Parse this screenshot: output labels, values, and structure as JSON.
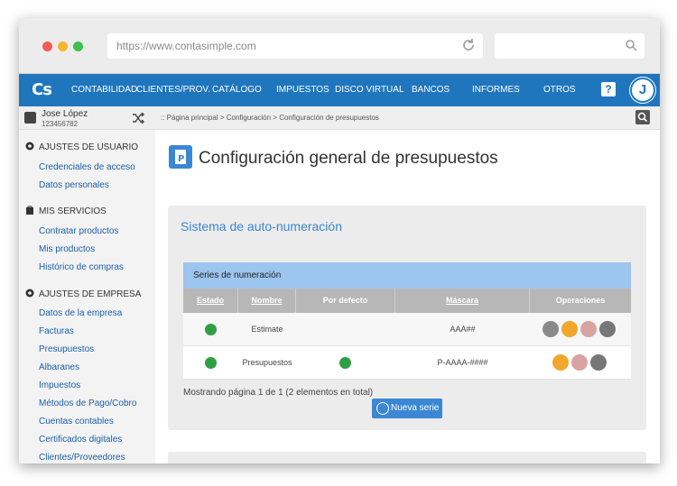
{
  "browser": {
    "url": "https://www.contasimple.com"
  },
  "topnav": {
    "logo": "Cs",
    "items": [
      "CONTABILIDAD",
      "CLIENTES/PROV.",
      "CATÁLOGO",
      "IMPUESTOS",
      "DISCO VIRTUAL",
      "BANCOS",
      "INFORMES",
      "OTROS"
    ],
    "help": "?",
    "avatar": "J",
    "color": "#1f76bd"
  },
  "user": {
    "name": "Jose López",
    "id": "123456782"
  },
  "breadcrumb": ":: Página principal > Configuración > Configuración de presupuestos",
  "sidebar": {
    "sections": [
      {
        "title": "AJUSTES DE USUARIO",
        "icon": "gear-icon",
        "items": [
          "Credenciales de acceso",
          "Datos personales"
        ]
      },
      {
        "title": "MIS SERVICIOS",
        "icon": "bag-icon",
        "items": [
          "Contratar productos",
          "Mis productos",
          "Histórico de compras"
        ]
      },
      {
        "title": "AJUSTES DE EMPRESA",
        "icon": "gear-icon",
        "items": [
          "Datos de la empresa",
          "Facturas",
          "Presupuestos",
          "Albaranes",
          "Impuestos",
          "Métodos de Pago/Cobro",
          "Cuentas contables",
          "Certificados digitales",
          "Clientes/Proveedores"
        ]
      }
    ]
  },
  "main": {
    "title": "Configuración general de presupuestos",
    "panel_title": "Sistema de auto-numeración",
    "grid": {
      "title": "Series de numeración",
      "columns": [
        "Estado",
        "Nombre",
        "Por defecto",
        "Máscara",
        "Operaciones"
      ],
      "rows": [
        {
          "estado": "active",
          "nombre": "Estimate",
          "por_defecto": false,
          "mascara": "AAA##"
        },
        {
          "estado": "active",
          "nombre": "Presupuestos",
          "por_defecto": true,
          "mascara": "P-AAAA-####"
        }
      ],
      "paging": "Mostrando página 1 de 1 (2 elementos en total)",
      "new_button": "Nueva serie"
    }
  }
}
